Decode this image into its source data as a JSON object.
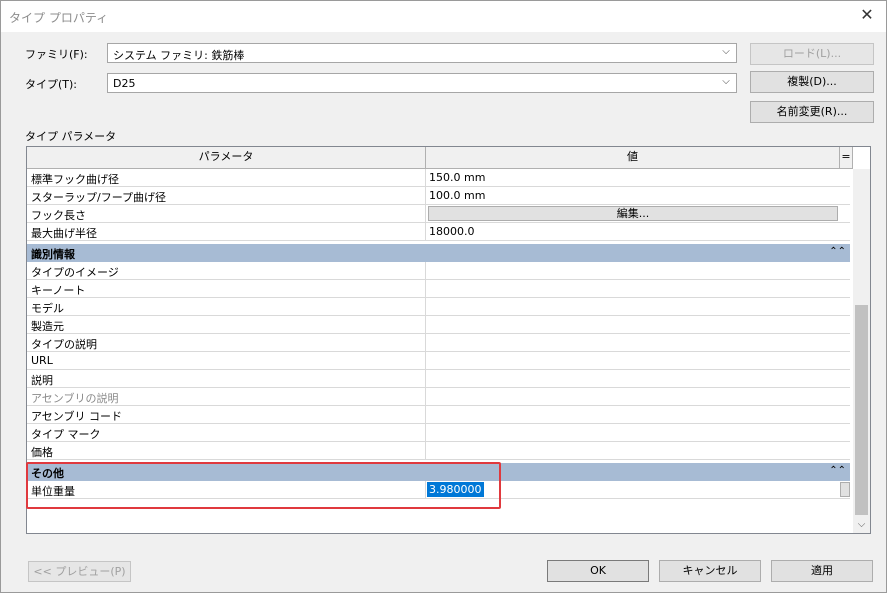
{
  "window": {
    "title": "タイプ プロパティ",
    "close_glyph": "✕"
  },
  "family": {
    "label": "ファミリ(F):",
    "value": "システム ファミリ: 鉄筋棒",
    "load_button": "ロード(L)..."
  },
  "type": {
    "label": "タイプ(T):",
    "value": "D25",
    "duplicate_button": "複製(D)...",
    "rename_button": "名前変更(R)..."
  },
  "params": {
    "section_label": "タイプ パラメータ",
    "col_param": "パラメータ",
    "col_value": "値",
    "col_extra": "=",
    "rows_top": [
      {
        "name": "標準フック曲げ径",
        "value": "150.0 mm"
      },
      {
        "name": "スターラップ/フープ曲げ径",
        "value": "100.0 mm"
      },
      {
        "name": "フック長さ",
        "value": ""
      },
      {
        "name": "最大曲げ半径",
        "value": "18000.0"
      }
    ],
    "edit_button": "編集...",
    "group_identity": "識別情報",
    "rows_identity": [
      {
        "name": "タイプのイメージ",
        "value": ""
      },
      {
        "name": "キーノート",
        "value": ""
      },
      {
        "name": "モデル",
        "value": ""
      },
      {
        "name": "製造元",
        "value": ""
      },
      {
        "name": "タイプの説明",
        "value": ""
      },
      {
        "name": "URL",
        "value": ""
      },
      {
        "name": "説明",
        "value": ""
      },
      {
        "name": "アセンブリの説明",
        "value": ""
      },
      {
        "name": "アセンブリ コード",
        "value": ""
      },
      {
        "name": "タイプ マーク",
        "value": ""
      },
      {
        "name": "価格",
        "value": ""
      }
    ],
    "group_other": "その他",
    "rows_other": [
      {
        "name": "単位重量",
        "value": "3.980000"
      }
    ],
    "collapse_glyph": "⌃⌃"
  },
  "footer": {
    "preview": "<< プレビュー(P)",
    "ok": "OK",
    "cancel": "キャンセル",
    "apply": "適用"
  },
  "colors": {
    "group_header": "#a7bbd4",
    "selection": "#0078d7",
    "highlight_box": "#e0393e"
  }
}
